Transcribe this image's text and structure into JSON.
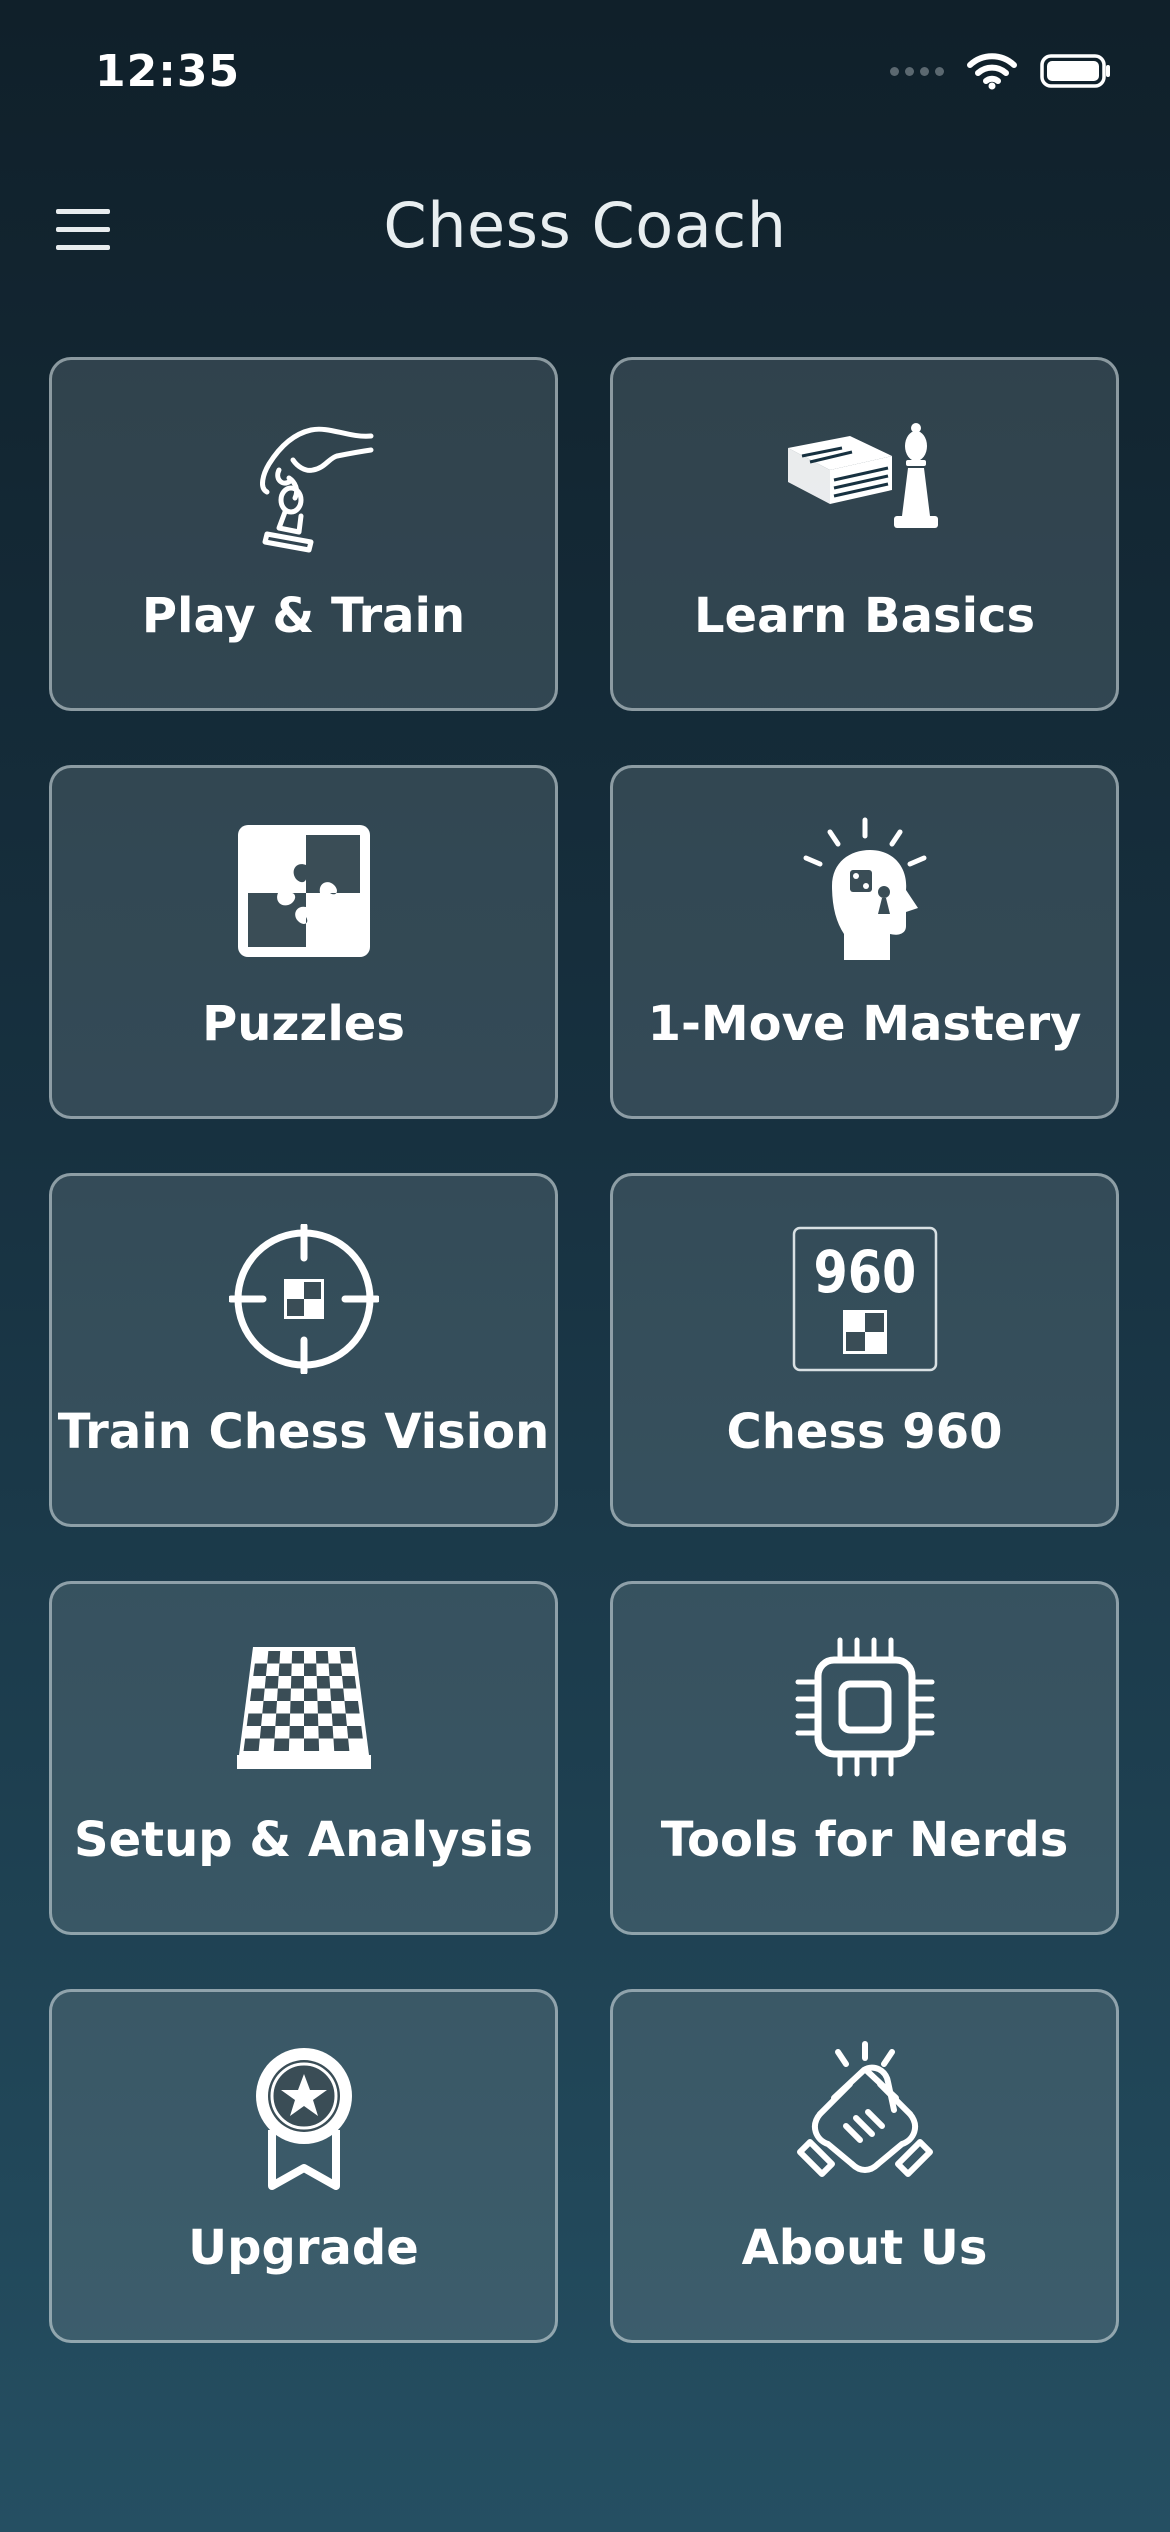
{
  "status_bar": {
    "time": "12:35"
  },
  "nav": {
    "title": "Chess Coach",
    "menu_icon": "hamburger-menu-icon"
  },
  "tiles": [
    {
      "label": "Play & Train",
      "icon": "hand-moving-pawn-icon"
    },
    {
      "label": "Learn Basics",
      "icon": "book-and-bishop-icon"
    },
    {
      "label": "Puzzles",
      "icon": "puzzle-piece-icon"
    },
    {
      "label": "1-Move Mastery",
      "icon": "head-idea-icon"
    },
    {
      "label": "Train Chess Vision",
      "icon": "crosshair-target-icon"
    },
    {
      "label": "Chess 960",
      "icon": "chess960-icon",
      "icon_text": "960"
    },
    {
      "label": "Setup & Analysis",
      "icon": "chessboard-icon"
    },
    {
      "label": "Tools for Nerds",
      "icon": "cpu-chip-icon"
    },
    {
      "label": "Upgrade",
      "icon": "award-ribbon-icon"
    },
    {
      "label": "About Us",
      "icon": "handshake-icon"
    }
  ],
  "colors": {
    "tile_border": "#d7e1e6",
    "text": "#ffffff",
    "bg_top": "#10202a",
    "bg_bottom": "#254f62"
  }
}
